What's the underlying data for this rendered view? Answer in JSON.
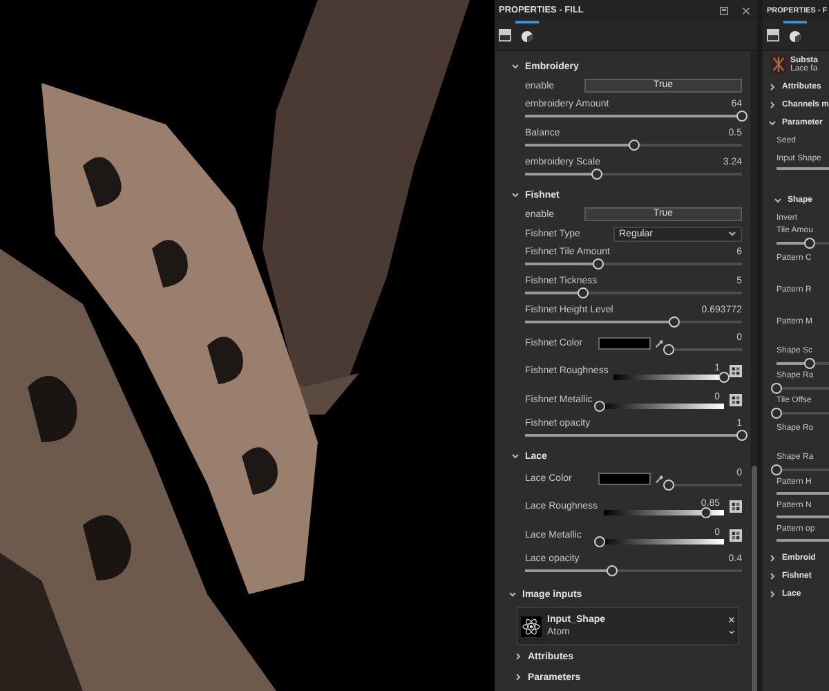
{
  "panel": {
    "title": "PROPERTIES - FILL",
    "sections": [
      {
        "title": "Embroidery",
        "expanded": true,
        "rows": [
          {
            "kind": "toggle",
            "label": "enable",
            "value": "True"
          },
          {
            "kind": "slider",
            "label": "embroidery Amount",
            "reading": "64",
            "level": 1
          },
          {
            "kind": "slider",
            "label": "Balance",
            "reading": "0.5",
            "level": 0.5
          },
          {
            "kind": "slider",
            "label": "embroidery Scale",
            "reading": "3.24",
            "level": 0.33
          }
        ]
      },
      {
        "title": "Fishnet",
        "expanded": true,
        "rows": [
          {
            "kind": "toggle",
            "label": "enable",
            "value": "True"
          },
          {
            "kind": "dropdown",
            "label": "Fishnet Type",
            "value": "Regular"
          },
          {
            "kind": "slider",
            "label": "Fishnet Tile Amount",
            "reading": "6",
            "level": 0.34
          },
          {
            "kind": "slider",
            "label": "Fishnet Tickness",
            "reading": "5",
            "level": 0.27
          },
          {
            "kind": "slider",
            "label": "Fishnet Height Level",
            "reading": "0.693772",
            "level": 0.69
          },
          {
            "kind": "color",
            "label": "Fishnet Color",
            "reading": "0",
            "level": 0,
            "color": "#000000"
          },
          {
            "kind": "gradient",
            "label": "Fishnet Roughness",
            "reading": "1",
            "level": 1
          },
          {
            "kind": "gradient",
            "label": "Fishnet Metallic",
            "reading": "0",
            "level": 0
          },
          {
            "kind": "slider",
            "label": "Fishnet opacity",
            "reading": "1",
            "level": 1
          }
        ]
      },
      {
        "title": "Lace",
        "expanded": true,
        "rows": [
          {
            "kind": "color",
            "label": "Lace Color",
            "reading": "0",
            "level": 0,
            "color": "#000000"
          },
          {
            "kind": "gradient",
            "label": "Lace Roughness",
            "reading": "0.85",
            "level": 0.85
          },
          {
            "kind": "gradient",
            "label": "Lace Metallic",
            "reading": "0",
            "level": 0
          },
          {
            "kind": "slider",
            "label": "Lace opacity",
            "reading": "0.4",
            "level": 0.4
          }
        ]
      }
    ],
    "image_inputs": {
      "title": "Image inputs",
      "expanded": true,
      "input": {
        "name": "Input_Shape",
        "resource": "Atom"
      }
    },
    "collapsed": [
      {
        "title": "Attributes",
        "expanded": false
      },
      {
        "title": "Parameters",
        "expanded": false
      }
    ]
  },
  "side_panel": {
    "title": "PROPERTIES - F",
    "resource": {
      "name": "Substa",
      "subtitle": "Lace fa"
    },
    "items": [
      {
        "kind": "section",
        "label": "Attributes",
        "expanded": false
      },
      {
        "kind": "section",
        "label": "Channels m",
        "expanded": false
      },
      {
        "kind": "section",
        "label": "Parameter",
        "expanded": true
      },
      {
        "kind": "label",
        "label": "Seed"
      },
      {
        "kind": "label",
        "label": "Input Shape"
      },
      {
        "kind": "line",
        "level": 1
      },
      {
        "kind": "subsection",
        "label": "Shape",
        "expanded": true
      },
      {
        "kind": "label",
        "label": "Invert"
      },
      {
        "kind": "slider",
        "label": "Tile Amou",
        "level": 0.6
      },
      {
        "kind": "tall",
        "label": "Pattern C"
      },
      {
        "kind": "tall",
        "label": "Pattern R"
      },
      {
        "kind": "tall",
        "label": "Pattern M"
      },
      {
        "kind": "slider",
        "label": "Shape Sc",
        "level": 0.6
      },
      {
        "kind": "slider",
        "label": "Shape Ra",
        "level": 0
      },
      {
        "kind": "slider",
        "label": "Tile Offse",
        "level": 0
      },
      {
        "kind": "tall",
        "label": "Shape Ro"
      },
      {
        "kind": "slider",
        "label": "Shape Ra",
        "level": 0
      },
      {
        "kind": "line",
        "label": "Pattern H",
        "level": 1
      },
      {
        "kind": "line",
        "label": "Pattern N",
        "level": 1
      },
      {
        "kind": "line",
        "label": "Pattern op",
        "level": 1
      },
      {
        "kind": "section",
        "label": "Embroid",
        "expanded": false
      },
      {
        "kind": "section",
        "label": "Fishnet",
        "expanded": false
      },
      {
        "kind": "section",
        "label": "Lace",
        "expanded": false
      }
    ]
  }
}
